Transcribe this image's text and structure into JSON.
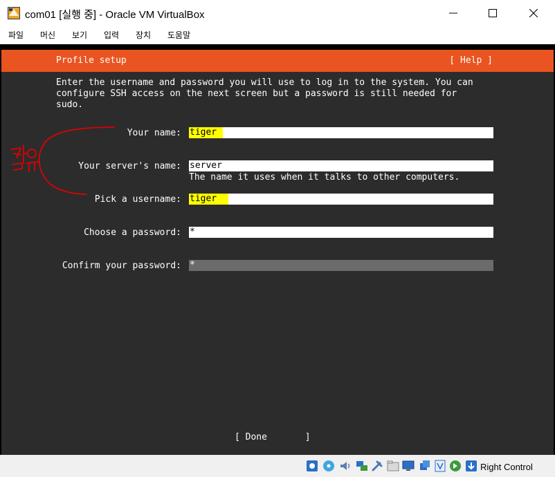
{
  "window": {
    "title": "com01 [실행 중] - Oracle VM VirtualBox"
  },
  "menu": {
    "items": [
      "파일",
      "머신",
      "보기",
      "입력",
      "장치",
      "도움말"
    ]
  },
  "installer": {
    "header_title": "Profile setup",
    "help_label": "[ Help ]",
    "intro": "Enter the username and password you will use to log in to the system. You can\nconfigure SSH access on the next screen but a password is still needed for\nsudo.",
    "fields": {
      "your_name": {
        "label": "Your name:",
        "value": "tiger "
      },
      "server_name": {
        "label": "Your server's name:",
        "value": "server",
        "hint": "The name it uses when it talks to other computers."
      },
      "username": {
        "label": "Pick a username:",
        "value": "tiger  "
      },
      "password": {
        "label": "Choose a password:",
        "value": "*"
      },
      "confirm_password": {
        "label": "Confirm your password:",
        "value": "*"
      }
    },
    "done_label": "[ Done       ]"
  },
  "annotation": {
    "handwritten_text": "같음",
    "color": "#e00000"
  },
  "statusbar": {
    "host_key_label": "Right Control",
    "icons": [
      "hard-disk-icon",
      "optical-drive-icon",
      "audio-icon",
      "network-icon",
      "usb-icon",
      "shared-folder-icon",
      "display-icon",
      "recording-icon",
      "virtualization-icon",
      "mouse-integration-icon",
      "keyboard-capture-icon"
    ]
  },
  "colors": {
    "accent": "#e95420",
    "installer_bg": "#2c2c2c",
    "highlight": "#ffff00"
  }
}
